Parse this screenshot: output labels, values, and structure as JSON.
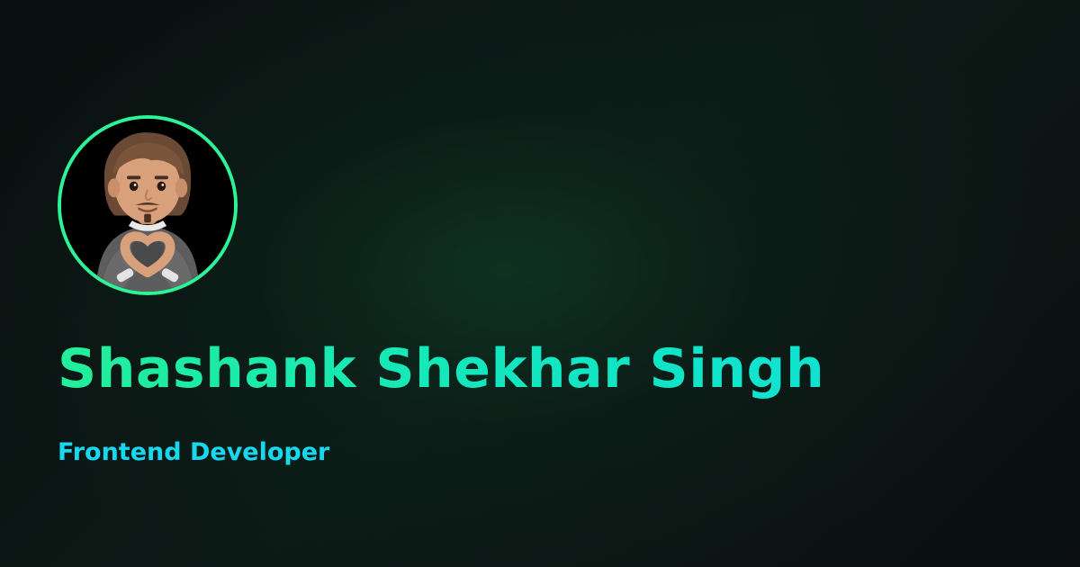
{
  "profile": {
    "name": "Shashank Shekhar Singh",
    "role": "Frontend Developer",
    "avatar_icon": "memoji-heart-hands-icon"
  },
  "colors": {
    "background": "#0b1411",
    "accent_ring": "#2cf29a",
    "name_text": "#1de9b6",
    "role_text": "#18d8f0"
  }
}
